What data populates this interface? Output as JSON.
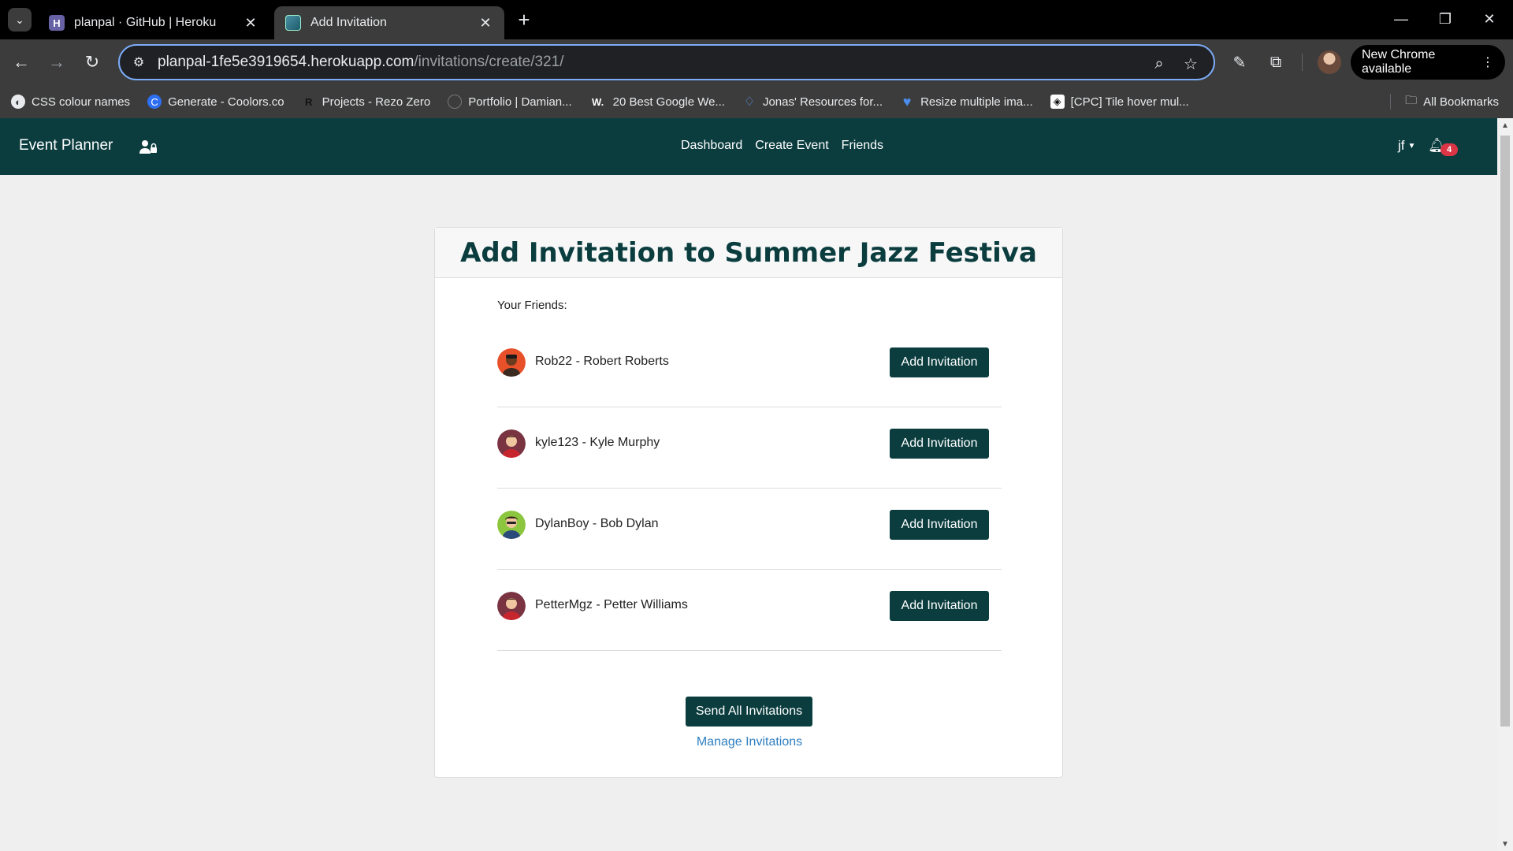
{
  "browser": {
    "tabs": [
      {
        "title": "planpal · GitHub | Heroku",
        "favicon_letter": "H"
      },
      {
        "title": "Add Invitation"
      }
    ],
    "url": {
      "host": "planpal-1fe5e3919654.herokuapp.com",
      "path": "/invitations/create/321/"
    },
    "update_label": "New Chrome available",
    "bookmarks": [
      {
        "label": "CSS colour names"
      },
      {
        "label": "Generate - Coolors.co"
      },
      {
        "label": "Projects - Rezo Zero",
        "icon_letter": "R"
      },
      {
        "label": "Portfolio | Damian..."
      },
      {
        "label": "20 Best Google We...",
        "icon_letter": "W."
      },
      {
        "label": "Jonas' Resources for..."
      },
      {
        "label": "Resize multiple ima..."
      },
      {
        "label": "[CPC] Tile hover mul..."
      }
    ],
    "all_bookmarks": "All Bookmarks"
  },
  "app": {
    "brand": "Event Planner",
    "nav": [
      "Dashboard",
      "Create Event",
      "Friends"
    ],
    "user": "jf",
    "notification_count": "4",
    "colors": {
      "primary": "#0b3d3f",
      "badge": "#dc3545",
      "link": "#2f7fc1"
    }
  },
  "page": {
    "title": "Add Invitation to Summer Jazz Festiva",
    "friends_label": "Your Friends:",
    "friends": [
      {
        "name": "Rob22 - Robert Roberts",
        "button": "Add Invitation",
        "avatar": "orange"
      },
      {
        "name": "kyle123 - Kyle Murphy",
        "button": "Add Invitation",
        "avatar": "maroon"
      },
      {
        "name": "DylanBoy - Bob Dylan",
        "button": "Add Invitation",
        "avatar": "green"
      },
      {
        "name": "PetterMgz - Petter Williams",
        "button": "Add Invitation",
        "avatar": "maroon"
      }
    ],
    "send_all": "Send All Invitations",
    "manage": "Manage Invitations"
  }
}
